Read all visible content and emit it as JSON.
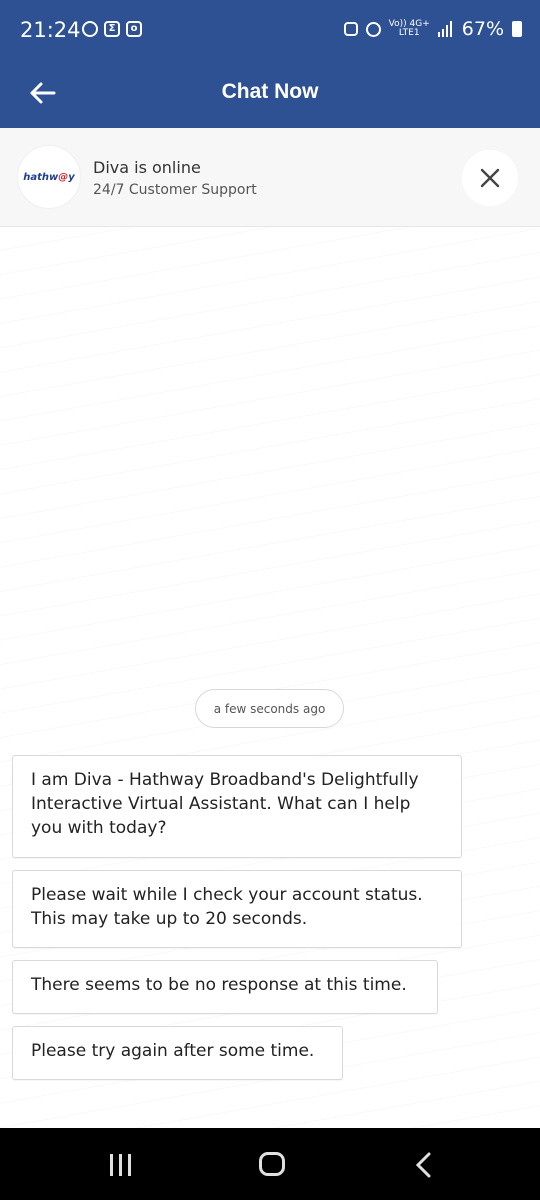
{
  "status_bar": {
    "time": "21:24",
    "network_top": "Vo)) 4G+",
    "network_bottom": "LTE1",
    "battery": "67%"
  },
  "app_bar": {
    "title": "Chat Now",
    "back_icon": "arrow-left-icon"
  },
  "agent": {
    "logo_text_1": "hathw",
    "logo_text_2": "@",
    "logo_text_3": "y",
    "name": "Diva is online",
    "subtitle": "24/7 Customer Support",
    "close_icon": "close-icon"
  },
  "chat": {
    "timestamp": "a few seconds ago",
    "messages": [
      {
        "text": "I am Diva - Hathway Broadband's Delightfully Interactive Virtual Assistant. What can I help you with today?"
      },
      {
        "text": "Please wait while I check your account status. This may take up to 20 seconds."
      },
      {
        "text": "There seems to be no response at this time."
      },
      {
        "text": "Please try again after some time."
      }
    ]
  },
  "nav_bar": {
    "recents_icon": "recents-icon",
    "home_icon": "home-icon",
    "back_icon": "chevron-left-icon"
  },
  "colors": {
    "header_blue": "#2d5193",
    "logo_blue": "#1f3f8f",
    "logo_red": "#d0202f"
  }
}
